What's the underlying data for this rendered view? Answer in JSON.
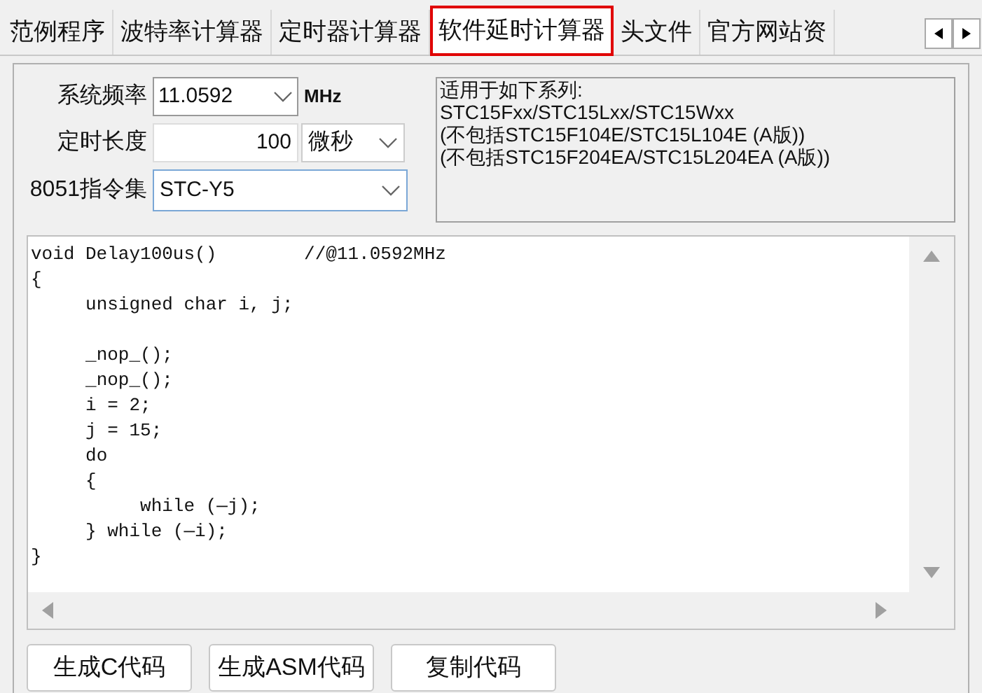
{
  "tabs": [
    {
      "label": "范例程序",
      "selected": false
    },
    {
      "label": "波特率计算器",
      "selected": false
    },
    {
      "label": "定时器计算器",
      "selected": false
    },
    {
      "label": "软件延时计算器",
      "selected": true
    },
    {
      "label": "头文件",
      "selected": false
    },
    {
      "label": "官方网站资",
      "selected": false
    }
  ],
  "form": {
    "frequency": {
      "label": "系统频率",
      "value": "11.0592",
      "unit": "MHz"
    },
    "duration": {
      "label": "定时长度",
      "value": "100",
      "unit": "微秒"
    },
    "instruction_set": {
      "label": "8051指令集",
      "value": "STC-Y5"
    }
  },
  "info": [
    "适用于如下系列:",
    "STC15Fxx/STC15Lxx/STC15Wxx",
    "(不包括STC15F104E/STC15L104E (A版))",
    "(不包括STC15F204EA/STC15L204EA (A版))"
  ],
  "code": "void Delay100us()\t\t//@11.0592MHz\n{\n\tunsigned char i, j;\n\n\t_nop_();\n\t_nop_();\n\ti = 2;\n\tj = 15;\n\tdo\n\t{\n\t\twhile (—j);\n\t} while (—i);\n}",
  "buttons": [
    "生成C代码",
    "生成ASM代码",
    "复制代码"
  ]
}
